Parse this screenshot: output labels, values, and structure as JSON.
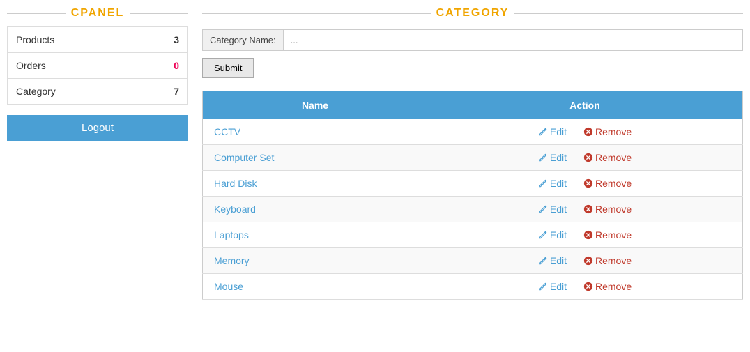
{
  "sidebar": {
    "title": "CPANEL",
    "items": [
      {
        "label": "Products",
        "count": "3",
        "countColor": "normal"
      },
      {
        "label": "Orders",
        "count": "0",
        "countColor": "red"
      },
      {
        "label": "Category",
        "count": "7",
        "countColor": "normal"
      }
    ],
    "logout_label": "Logout"
  },
  "main": {
    "title": "CATEGORY",
    "form": {
      "label": "Category Name:",
      "placeholder": "...",
      "submit_label": "Submit"
    },
    "table": {
      "col_name": "Name",
      "col_action": "Action",
      "edit_label": "Edit",
      "remove_label": "Remove",
      "rows": [
        {
          "name": "CCTV"
        },
        {
          "name": "Computer Set"
        },
        {
          "name": "Hard Disk"
        },
        {
          "name": "Keyboard"
        },
        {
          "name": "Laptops"
        },
        {
          "name": "Memory"
        },
        {
          "name": "Mouse"
        }
      ]
    }
  }
}
